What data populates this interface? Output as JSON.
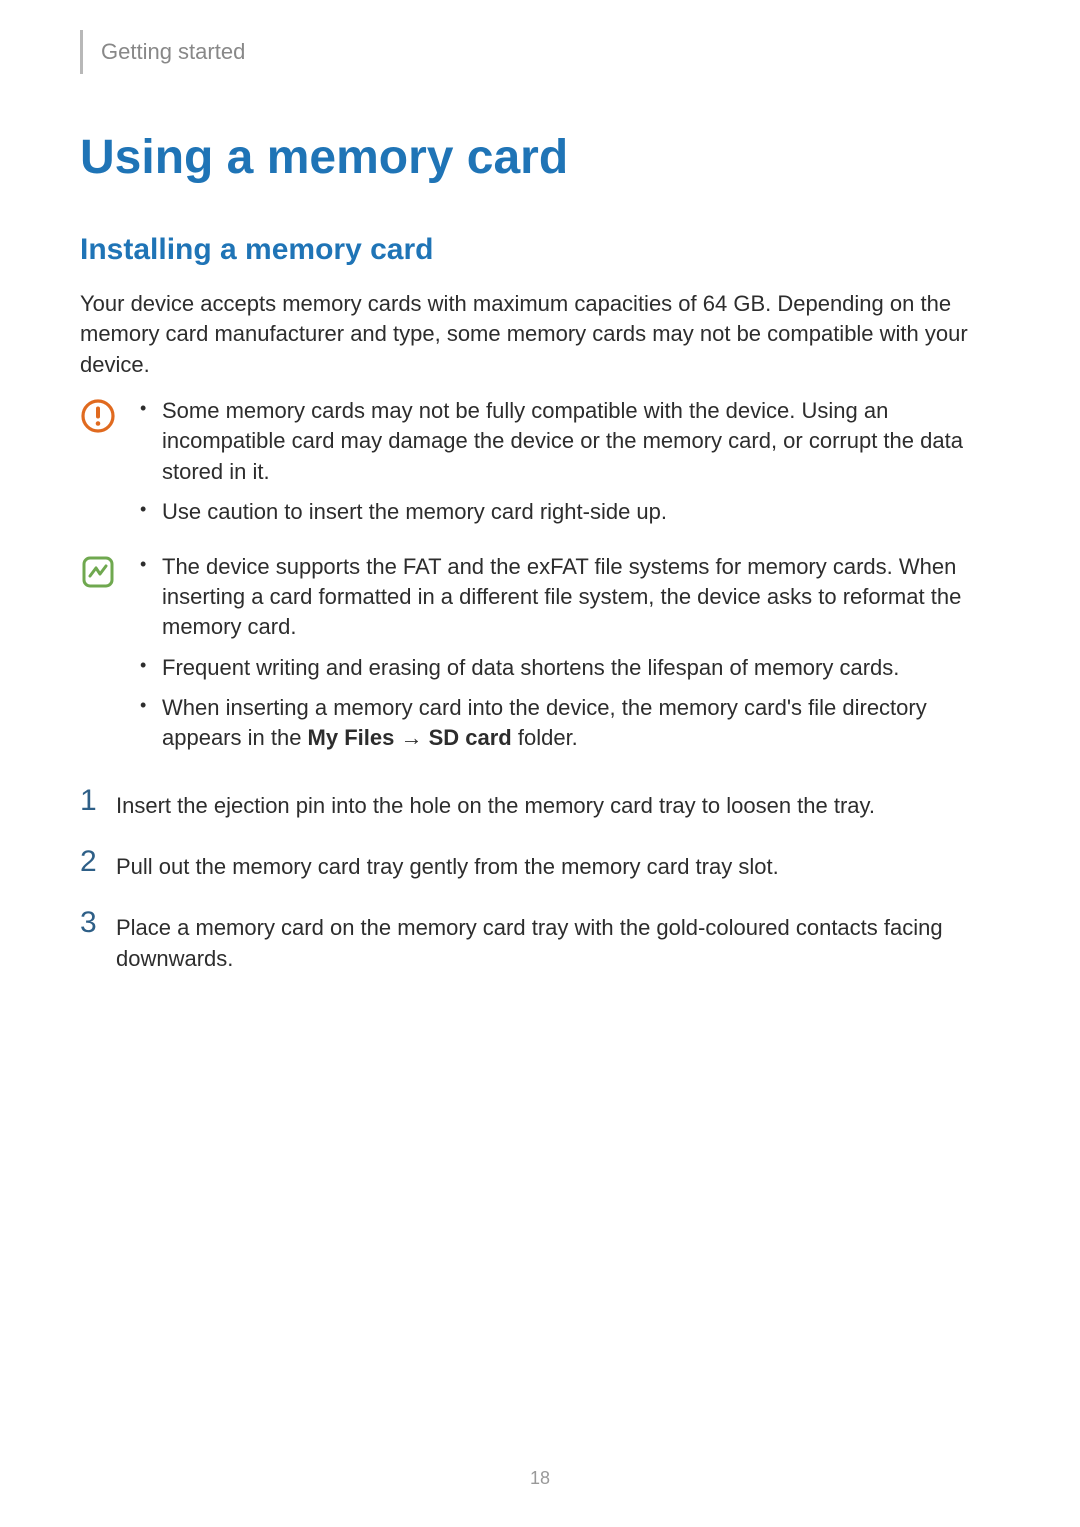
{
  "header": {
    "breadcrumb": "Getting started"
  },
  "title": "Using a memory card",
  "subtitle": "Installing a memory card",
  "intro": "Your device accepts memory cards with maximum capacities of 64 GB. Depending on the memory card manufacturer and type, some memory cards may not be compatible with your device.",
  "caution": {
    "items": [
      "Some memory cards may not be fully compatible with the device. Using an incompatible card may damage the device or the memory card, or corrupt the data stored in it.",
      "Use caution to insert the memory card right-side up."
    ]
  },
  "note": {
    "items": [
      "The device supports the FAT and the exFAT file systems for memory cards. When inserting a card formatted in a different file system, the device asks to reformat the memory card.",
      "Frequent writing and erasing of data shortens the lifespan of memory cards."
    ],
    "rich": {
      "before": "When inserting a memory card into the device, the memory card's file directory appears in the ",
      "b1": "My Files",
      "arrow": " → ",
      "b2": "SD card",
      "after": " folder."
    }
  },
  "steps": [
    {
      "n": "1",
      "text": "Insert the ejection pin into the hole on the memory card tray to loosen the tray."
    },
    {
      "n": "2",
      "text": "Pull out the memory card tray gently from the memory card tray slot."
    },
    {
      "n": "3",
      "text": "Place a memory card on the memory card tray with the gold-coloured contacts facing downwards."
    }
  ],
  "page_number": "18"
}
